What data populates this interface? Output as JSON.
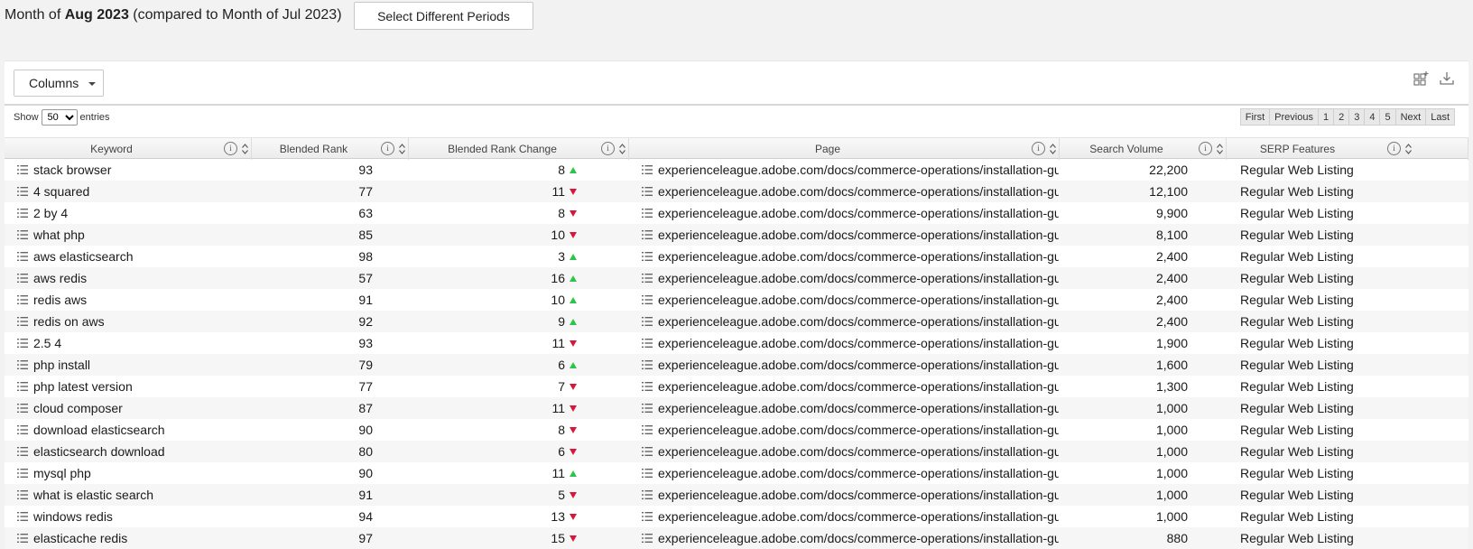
{
  "header": {
    "prefix": "Month of ",
    "period": "Aug 2023",
    "comparison": "(compared to Month of Jul 2023)",
    "select_periods_label": "Select Different Periods"
  },
  "toolbar": {
    "columns_label": "Columns",
    "icons": [
      "grid-add-icon",
      "download-icon"
    ]
  },
  "controls": {
    "show_label": "Show",
    "entries_value": "50",
    "entries_label": "entries",
    "pager": [
      "First",
      "Previous",
      "1",
      "2",
      "3",
      "4",
      "5",
      "Next",
      "Last"
    ]
  },
  "table": {
    "columns": [
      "Keyword",
      "Blended Rank",
      "Blended Rank Change",
      "Page",
      "Search Volume",
      "SERP Features"
    ],
    "colors": {
      "up": "#2ec44a",
      "down": "#d2183c",
      "alt_row": "#f6f6f6"
    },
    "rows": [
      {
        "keyword": "stack browser",
        "rank": "93",
        "change": "8",
        "dir": "up",
        "page": "experienceleague.adobe.com/docs/commerce-operations/installation-guide",
        "volume": "22,200",
        "serp": "Regular Web Listing"
      },
      {
        "keyword": "4 squared",
        "rank": "77",
        "change": "11",
        "dir": "down",
        "page": "experienceleague.adobe.com/docs/commerce-operations/installation-guide",
        "volume": "12,100",
        "serp": "Regular Web Listing"
      },
      {
        "keyword": "2 by 4",
        "rank": "63",
        "change": "8",
        "dir": "down",
        "page": "experienceleague.adobe.com/docs/commerce-operations/installation-guide",
        "volume": "9,900",
        "serp": "Regular Web Listing"
      },
      {
        "keyword": "what php",
        "rank": "85",
        "change": "10",
        "dir": "down",
        "page": "experienceleague.adobe.com/docs/commerce-operations/installation-guide",
        "volume": "8,100",
        "serp": "Regular Web Listing"
      },
      {
        "keyword": "aws elasticsearch",
        "rank": "98",
        "change": "3",
        "dir": "up",
        "page": "experienceleague.adobe.com/docs/commerce-operations/installation-guide",
        "volume": "2,400",
        "serp": "Regular Web Listing"
      },
      {
        "keyword": "aws redis",
        "rank": "57",
        "change": "16",
        "dir": "up",
        "page": "experienceleague.adobe.com/docs/commerce-operations/installation-guide",
        "volume": "2,400",
        "serp": "Regular Web Listing"
      },
      {
        "keyword": "redis aws",
        "rank": "91",
        "change": "10",
        "dir": "up",
        "page": "experienceleague.adobe.com/docs/commerce-operations/installation-guide",
        "volume": "2,400",
        "serp": "Regular Web Listing"
      },
      {
        "keyword": "redis on aws",
        "rank": "92",
        "change": "9",
        "dir": "up",
        "page": "experienceleague.adobe.com/docs/commerce-operations/installation-guide",
        "volume": "2,400",
        "serp": "Regular Web Listing"
      },
      {
        "keyword": "2.5 4",
        "rank": "93",
        "change": "11",
        "dir": "down",
        "page": "experienceleague.adobe.com/docs/commerce-operations/installation-guide",
        "volume": "1,900",
        "serp": "Regular Web Listing"
      },
      {
        "keyword": "php install",
        "rank": "79",
        "change": "6",
        "dir": "up",
        "page": "experienceleague.adobe.com/docs/commerce-operations/installation-guide",
        "volume": "1,600",
        "serp": "Regular Web Listing"
      },
      {
        "keyword": "php latest version",
        "rank": "77",
        "change": "7",
        "dir": "down",
        "page": "experienceleague.adobe.com/docs/commerce-operations/installation-guide",
        "volume": "1,300",
        "serp": "Regular Web Listing"
      },
      {
        "keyword": "cloud composer",
        "rank": "87",
        "change": "11",
        "dir": "down",
        "page": "experienceleague.adobe.com/docs/commerce-operations/installation-guide",
        "volume": "1,000",
        "serp": "Regular Web Listing"
      },
      {
        "keyword": "download elasticsearch",
        "rank": "90",
        "change": "8",
        "dir": "down",
        "page": "experienceleague.adobe.com/docs/commerce-operations/installation-guide",
        "volume": "1,000",
        "serp": "Regular Web Listing"
      },
      {
        "keyword": "elasticsearch download",
        "rank": "80",
        "change": "6",
        "dir": "down",
        "page": "experienceleague.adobe.com/docs/commerce-operations/installation-guide",
        "volume": "1,000",
        "serp": "Regular Web Listing"
      },
      {
        "keyword": "mysql php",
        "rank": "90",
        "change": "11",
        "dir": "up",
        "page": "experienceleague.adobe.com/docs/commerce-operations/installation-guide",
        "volume": "1,000",
        "serp": "Regular Web Listing"
      },
      {
        "keyword": "what is elastic search",
        "rank": "91",
        "change": "5",
        "dir": "down",
        "page": "experienceleague.adobe.com/docs/commerce-operations/installation-guide",
        "volume": "1,000",
        "serp": "Regular Web Listing"
      },
      {
        "keyword": "windows redis",
        "rank": "94",
        "change": "13",
        "dir": "down",
        "page": "experienceleague.adobe.com/docs/commerce-operations/installation-guide",
        "volume": "1,000",
        "serp": "Regular Web Listing"
      },
      {
        "keyword": "elasticache redis",
        "rank": "97",
        "change": "15",
        "dir": "down",
        "page": "experienceleague.adobe.com/docs/commerce-operations/installation-guide",
        "volume": "880",
        "serp": "Regular Web Listing"
      }
    ]
  }
}
